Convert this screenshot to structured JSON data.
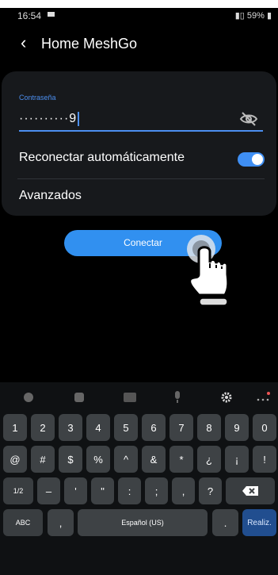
{
  "status_bar": {
    "time": "16:54",
    "right_text": "59%"
  },
  "header": {
    "title": "Home MeshGo"
  },
  "password": {
    "label": "Contraseña",
    "value": "··········9"
  },
  "settings": {
    "auto_reconnect_label": "Reconectar automáticamente",
    "advanced_label": "Avanzados"
  },
  "auto_reconnect_on": true,
  "connect_button": {
    "label": "Conectar"
  },
  "keyboard": {
    "numbers": [
      "1",
      "2",
      "3",
      "4",
      "5",
      "6",
      "7",
      "8",
      "9",
      "0"
    ],
    "symbols": [
      "@",
      "#",
      "$",
      "%",
      "^",
      "&",
      "*",
      "¿",
      "¡",
      "!"
    ],
    "symbols2": [
      "1/2",
      "–",
      "'",
      "\"",
      ":",
      ";",
      ",",
      "?"
    ],
    "bottom": {
      "abc": "ABC",
      "comma": ",",
      "space": "Español (US)",
      "period": ".",
      "enter": "Realiz."
    }
  },
  "colors": {
    "accent": "#3190f0",
    "background": "#000000",
    "card": "#17191c",
    "key": "#3e4245"
  }
}
